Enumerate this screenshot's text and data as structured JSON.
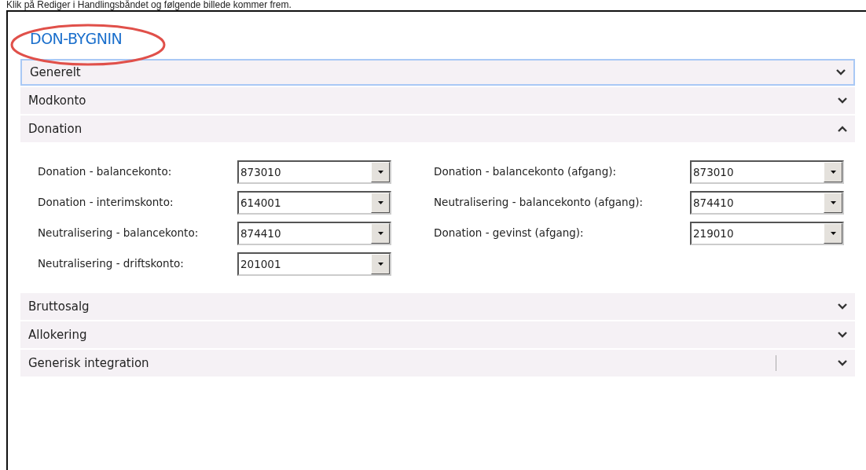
{
  "caption": "Klik på Rediger i Handlingsbåndet og følgende billede kommer frem.",
  "title": "DON-BYGNIN",
  "title_highlighted": true,
  "sections": [
    {
      "label": "Generelt",
      "expanded": false,
      "focused": true,
      "divider": false
    },
    {
      "label": "Modkonto",
      "expanded": false,
      "focused": false,
      "divider": false
    },
    {
      "label": "Donation",
      "expanded": true,
      "focused": false,
      "divider": false,
      "columns": [
        [
          {
            "label": "Donation - balancekonto:",
            "value": "873010"
          },
          {
            "label": "Donation - interimskonto:",
            "value": "614001"
          },
          {
            "label": "Neutralisering - balancekonto:",
            "value": "874410"
          },
          {
            "label": "Neutralisering - driftskonto:",
            "value": "201001"
          }
        ],
        [
          {
            "label": "Donation - balancekonto (afgang):",
            "value": "873010"
          },
          {
            "label": "Neutralisering - balancekonto (afgang):",
            "value": "874410"
          },
          {
            "label": "Donation - gevinst (afgang):",
            "value": "219010"
          }
        ]
      ]
    },
    {
      "label": "Bruttosalg",
      "expanded": false,
      "focused": false,
      "divider": false
    },
    {
      "label": "Allokering",
      "expanded": false,
      "focused": false,
      "divider": false
    },
    {
      "label": "Generisk integration",
      "expanded": false,
      "focused": false,
      "divider": true
    }
  ]
}
